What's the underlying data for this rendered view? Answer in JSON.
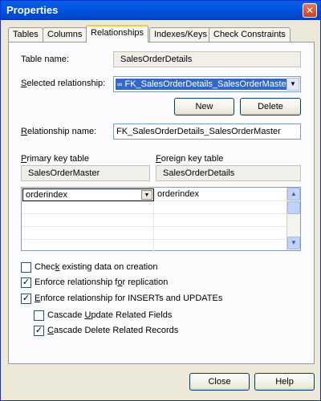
{
  "window": {
    "title": "Properties"
  },
  "tabs": [
    {
      "label": "Tables"
    },
    {
      "label": "Columns"
    },
    {
      "label": "Relationships",
      "active": true
    },
    {
      "label": "Indexes/Keys"
    },
    {
      "label": "Check Constraints"
    }
  ],
  "relationships": {
    "table_name_label": "Table name:",
    "table_name_value": "SalesOrderDetails",
    "selected_relationship_label": "Selected relationship:",
    "selected_relationship_value": "FK_SalesOrderDetails_SalesOrderMaster",
    "new_button": "New",
    "delete_button": "Delete",
    "relationship_name_label": "Relationship name:",
    "relationship_name_value": "FK_SalesOrderDetails_SalesOrderMaster",
    "primary_key_table_label": "Primary key table",
    "primary_key_table_value": "SalesOrderMaster",
    "foreign_key_table_label": "Foreign key table",
    "foreign_key_table_value": "SalesOrderDetails",
    "column_mappings": [
      {
        "primary": "orderindex",
        "foreign": "orderindex"
      }
    ]
  },
  "options": [
    {
      "label": "Check existing data on creation",
      "checked": false
    },
    {
      "label": "Enforce relationship for replication",
      "checked": true
    },
    {
      "label": "Enforce relationship for INSERTs and UPDATEs",
      "checked": true
    },
    {
      "label": "Cascade Update Related Fields",
      "checked": false
    },
    {
      "label": "Cascade Delete Related Records",
      "checked": true
    }
  ],
  "footer": {
    "close_button": "Close",
    "help_button": "Help"
  },
  "colors": {
    "titlebar": "#0055e5",
    "selection": "#316ac5",
    "dialog_bg": "#ece9d8",
    "active_tab_highlight": "#ffc73c"
  },
  "icons": {
    "titlebar_close": "close-icon",
    "relationship": "relationship-link-icon",
    "dropdown": "chevron-down-icon"
  }
}
